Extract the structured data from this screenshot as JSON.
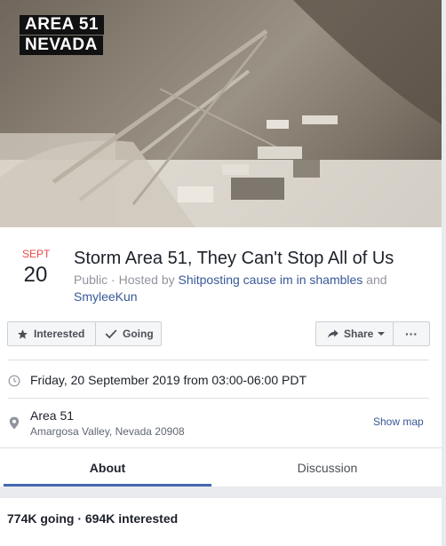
{
  "cover": {
    "line1": "AREA 51",
    "line2": "NEVADA"
  },
  "event": {
    "month": "SEPT",
    "day": "20",
    "title": "Storm Area 51, They Can't Stop All of Us",
    "privacy": "Public",
    "hosted_prefix": " · Hosted by ",
    "host1": "Shitposting cause im in shambles",
    "and": " and ",
    "host2": "SmyleeKun"
  },
  "actions": {
    "interested": "Interested",
    "going": "Going",
    "share": "Share",
    "more": "···"
  },
  "details": {
    "datetime": "Friday, 20 September 2019 from 03:00-06:00 PDT",
    "location_name": "Area 51",
    "location_address": "Amargosa Valley, Nevada 20908",
    "show_map": "Show map"
  },
  "tabs": [
    {
      "label": "About",
      "active": true
    },
    {
      "label": "Discussion",
      "active": false
    }
  ],
  "stats": "774K going · 694K interested",
  "colors": {
    "accent": "#4267b2",
    "month": "#e64a4a",
    "link": "#385898"
  }
}
